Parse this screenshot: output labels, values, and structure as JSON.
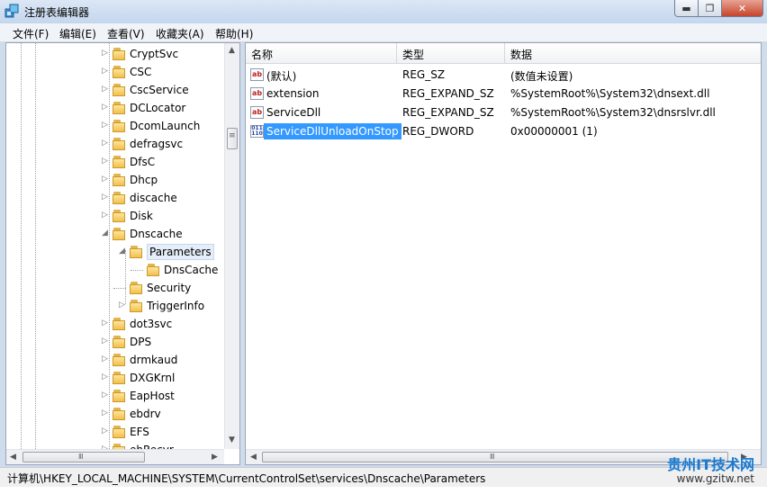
{
  "window": {
    "title": "注册表编辑器",
    "icon": "regedit-icon",
    "min_label": "▬",
    "max_label": "❐",
    "close_label": "✕"
  },
  "menu": [
    "文件(F)",
    "编辑(E)",
    "查看(V)",
    "收藏夹(A)",
    "帮助(H)"
  ],
  "tree": [
    {
      "label": "CryptSvc",
      "level": 0,
      "arrow": "▷"
    },
    {
      "label": "CSC",
      "level": 0,
      "arrow": "▷"
    },
    {
      "label": "CscService",
      "level": 0,
      "arrow": "▷"
    },
    {
      "label": "DCLocator",
      "level": 0,
      "arrow": "▷"
    },
    {
      "label": "DcomLaunch",
      "level": 0,
      "arrow": "▷"
    },
    {
      "label": "defragsvc",
      "level": 0,
      "arrow": "▷"
    },
    {
      "label": "DfsC",
      "level": 0,
      "arrow": "▷"
    },
    {
      "label": "Dhcp",
      "level": 0,
      "arrow": "▷"
    },
    {
      "label": "discache",
      "level": 0,
      "arrow": "▷"
    },
    {
      "label": "Disk",
      "level": 0,
      "arrow": "▷"
    },
    {
      "label": "Dnscache",
      "level": 0,
      "arrow": "◢"
    },
    {
      "label": "Parameters",
      "level": 1,
      "arrow": "◢",
      "selected": true
    },
    {
      "label": "DnsCache",
      "level": 2,
      "arrow": ""
    },
    {
      "label": "Security",
      "level": 1,
      "arrow": ""
    },
    {
      "label": "TriggerInfo",
      "level": 1,
      "arrow": "▷"
    },
    {
      "label": "dot3svc",
      "level": 0,
      "arrow": "▷"
    },
    {
      "label": "DPS",
      "level": 0,
      "arrow": "▷"
    },
    {
      "label": "drmkaud",
      "level": 0,
      "arrow": "▷"
    },
    {
      "label": "DXGKrnl",
      "level": 0,
      "arrow": "▷"
    },
    {
      "label": "EapHost",
      "level": 0,
      "arrow": "▷"
    },
    {
      "label": "ebdrv",
      "level": 0,
      "arrow": "▷"
    },
    {
      "label": "EFS",
      "level": 0,
      "arrow": "▷"
    },
    {
      "label": "ehRecvr",
      "level": 0,
      "arrow": "▷"
    }
  ],
  "columns": {
    "name": "名称",
    "type": "类型",
    "data": "数据"
  },
  "values": [
    {
      "icon": "ab",
      "name": "(默认)",
      "type": "REG_SZ",
      "data": "(数值未设置)",
      "selected": false
    },
    {
      "icon": "ab",
      "name": "extension",
      "type": "REG_EXPAND_SZ",
      "data": "%SystemRoot%\\System32\\dnsext.dll",
      "selected": false
    },
    {
      "icon": "ab",
      "name": "ServiceDll",
      "type": "REG_EXPAND_SZ",
      "data": "%SystemRoot%\\System32\\dnsrslvr.dll",
      "selected": false
    },
    {
      "icon": "bin",
      "name": "ServiceDllUnloadOnStop",
      "type": "REG_DWORD",
      "data": "0x00000001 (1)",
      "selected": true
    }
  ],
  "icon_text": {
    "ab": "ab",
    "bin": "011\n110"
  },
  "scroll": {
    "left": "◀",
    "right": "▶",
    "up": "▲",
    "down": "▼",
    "grip": "Ⅲ",
    "vgrip": "≡"
  },
  "status": "计算机\\HKEY_LOCAL_MACHINE\\SYSTEM\\CurrentControlSet\\services\\Dnscache\\Parameters",
  "watermark": {
    "top": "贵州IT技术网",
    "bottom": "www.gzitw.net"
  }
}
